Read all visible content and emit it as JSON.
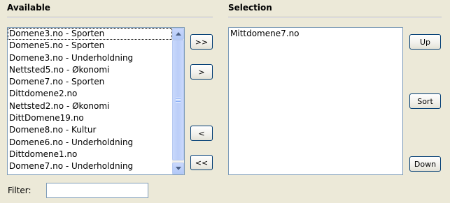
{
  "available": {
    "title": "Available",
    "items": [
      "Domene3.no - Sporten",
      "Domene5.no - Sporten",
      "Domene3.no - Underholdning",
      "Nettsted5.no - Økonomi",
      "Domene7.no - Sporten",
      "Dittdomene2.no",
      "Nettsted2.no - Økonomi",
      "DittDomene19.no",
      "Domene8.no - Kultur",
      "Domene6.no - Underholdning",
      "Dittdomene1.no",
      "Domene7.no - Underholdning"
    ]
  },
  "selection": {
    "title": "Selection",
    "items": [
      "Mittdomene7.no"
    ]
  },
  "buttons": {
    "add_all": ">>",
    "add": ">",
    "remove": "<",
    "remove_all": "<<",
    "up": "Up",
    "sort": "Sort",
    "down": "Down"
  },
  "filter": {
    "label": "Filter:",
    "value": ""
  }
}
